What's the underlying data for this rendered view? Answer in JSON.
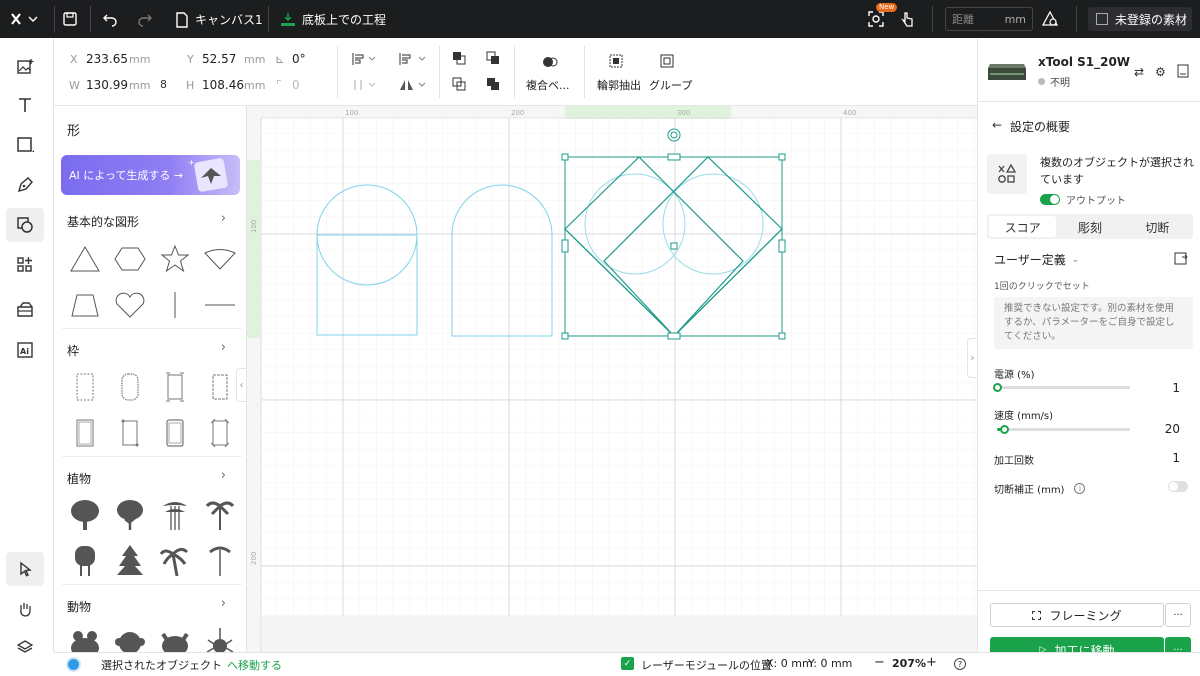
{
  "topbar": {
    "file_name": "キャンバス1",
    "process_label": "底板上での工程",
    "new_badge": "New",
    "distance_placeholder": "距離",
    "distance_unit": "mm",
    "unregistered_label": "未登録の素材"
  },
  "props": {
    "x_label": "X",
    "x_value": "233.65",
    "x_unit": "mm",
    "y_label": "Y",
    "y_value": "52.57",
    "y_unit": "mm",
    "rotate_value": "0°",
    "w_label": "W",
    "w_value": "130.99",
    "w_unit": "mm",
    "h_label": "H",
    "h_value": "108.46",
    "h_unit": "mm",
    "corner_value": "0",
    "combine_label": "複合ベ...",
    "outline_label": "輪郭抽出",
    "group_label": "グループ"
  },
  "shapes_panel": {
    "title": "形",
    "ai_banner": "AI によって生成する →",
    "sections": [
      {
        "title": "基本的な図形"
      },
      {
        "title": "枠"
      },
      {
        "title": "植物"
      },
      {
        "title": "動物"
      }
    ]
  },
  "canvas": {
    "ruler_top": [
      "100",
      "200",
      "300",
      "400"
    ],
    "ruler_left": [
      "100",
      "200"
    ]
  },
  "device": {
    "name": "xTool S1_20W",
    "status": "不明"
  },
  "settings": {
    "header": "設定の概要",
    "selected_text": "複数のオブジェクトが選択されています",
    "output_label": "アウトプット",
    "tabs": [
      "スコア",
      "彫刻",
      "切断"
    ],
    "preset_label": "ユーザー定義",
    "click_set": "1回のクリックでセット",
    "warning": "推奨できない設定です。別の素材を使用するか、パラメーターをご自身で設定してください。",
    "power_label": "電源 (%)",
    "power_value": "1",
    "power_fraction": 0.01,
    "speed_label": "速度 (mm/s)",
    "speed_value": "20",
    "speed_fraction": 0.06,
    "passes_label": "加工回数",
    "passes_value": "1",
    "kerf_label": "切断補正 (mm)",
    "framing_label": "フレーミング",
    "go_label": "加工に移動",
    "more": "···"
  },
  "status": {
    "selected_prefix": "選択されたオブジェクト",
    "move_link": "へ移動する",
    "laser_pos_label": "レーザーモジュールの位置",
    "x_coord": "X: 0 mm",
    "y_coord": "Y: 0 mm",
    "zoom": "207%"
  },
  "colors": {
    "topbar": "#1c1d1f",
    "accent_green": "#1aa34a",
    "shape_stroke": "#7fd3e8",
    "selected_stroke": "#1f9a8a"
  }
}
